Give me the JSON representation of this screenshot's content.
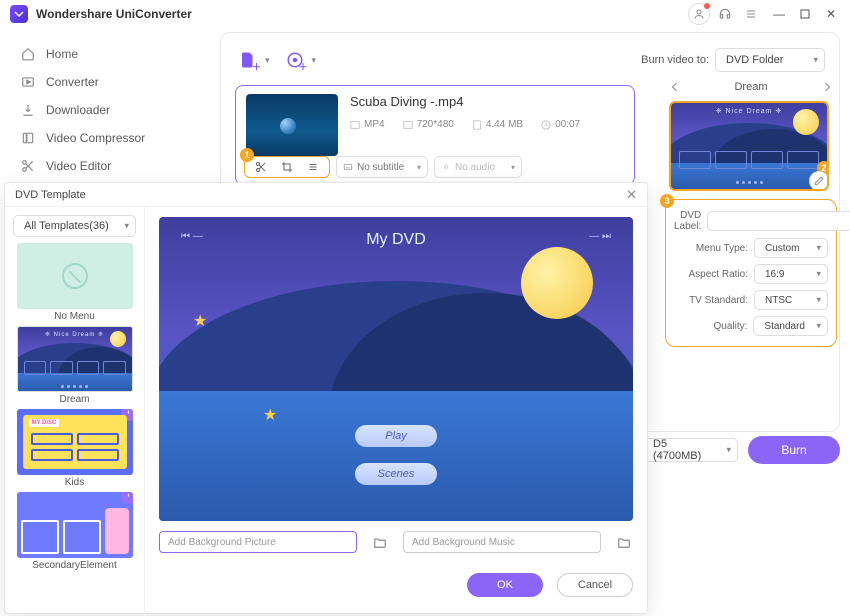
{
  "app": {
    "title": "Wondershare UniConverter"
  },
  "sidebar": {
    "items": [
      {
        "label": "Home"
      },
      {
        "label": "Converter"
      },
      {
        "label": "Downloader"
      },
      {
        "label": "Video Compressor"
      },
      {
        "label": "Video Editor"
      }
    ]
  },
  "toolbar": {
    "burn_to_label": "Burn video to:",
    "burn_target": "DVD Folder"
  },
  "video": {
    "title": "Scuba Diving -.mp4",
    "format": "MP4",
    "resolution": "720*480",
    "size": "4.44 MB",
    "duration": "00:07",
    "subtitle": "No subtitle",
    "audio": "No audio",
    "badge": "1"
  },
  "preview": {
    "pager_title": "Dream",
    "menu_title": "❈ Nice Dream ❈",
    "badge": "2"
  },
  "settings": {
    "badge": "3",
    "dvd_label_lbl": "DVD Label:",
    "dvd_label_val": "",
    "menu_type_lbl": "Menu Type:",
    "menu_type_val": "Custom",
    "aspect_lbl": "Aspect Ratio:",
    "aspect_val": "16:9",
    "tv_lbl": "TV Standard:",
    "tv_val": "NTSC",
    "quality_lbl": "Quality:",
    "quality_val": "Standard"
  },
  "bottom": {
    "disc": "D5 (4700MB)",
    "burn": "Burn"
  },
  "modal": {
    "title": "DVD Template",
    "filter": "All Templates(36)",
    "templates": [
      {
        "name": "No Menu"
      },
      {
        "name": "Dream"
      },
      {
        "name": "Kids"
      },
      {
        "name": "SecondaryElement"
      }
    ],
    "big_title": "My DVD",
    "kids_title": "MY DISC",
    "play": "Play",
    "scenes": "Scenes",
    "bg_pic_ph": "Add Background Picture",
    "bg_music_ph": "Add Background Music",
    "ok": "OK",
    "cancel": "Cancel"
  }
}
